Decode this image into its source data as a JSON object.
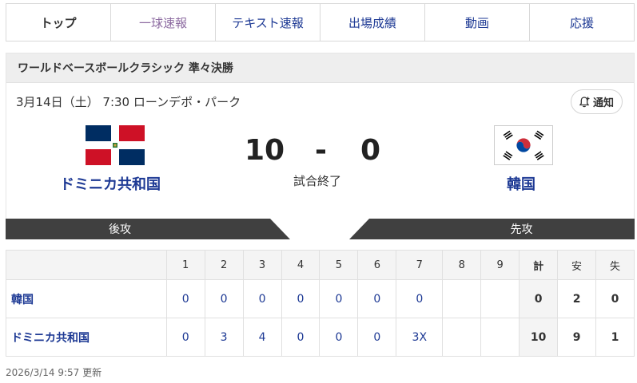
{
  "tabs": [
    {
      "label": "トップ"
    },
    {
      "label": "一球速報"
    },
    {
      "label": "テキスト速報"
    },
    {
      "label": "出場成績"
    },
    {
      "label": "動画"
    },
    {
      "label": "応援"
    }
  ],
  "game": {
    "title": "ワールドベースボールクラシック 準々決勝",
    "dateline": "3月14日（土） 7:30 ローンデポ・パーク",
    "notify_label": "通知",
    "home_team": "ドミニカ共和国",
    "away_team": "韓国",
    "home_score": "10",
    "dash": "-",
    "away_score": "0",
    "status": "試合終了",
    "home_side": "後攻",
    "away_side": "先攻"
  },
  "scoreboard": {
    "headers": [
      "1",
      "2",
      "3",
      "4",
      "5",
      "6",
      "7",
      "8",
      "9",
      "計",
      "安",
      "失"
    ],
    "rows": [
      {
        "team": "韓国",
        "innings": [
          "0",
          "0",
          "0",
          "0",
          "0",
          "0",
          "0",
          "",
          ""
        ],
        "runs": "0",
        "hits": "2",
        "errors": "0"
      },
      {
        "team": "ドミニカ共和国",
        "innings": [
          "0",
          "3",
          "4",
          "0",
          "0",
          "0",
          "3X",
          "",
          ""
        ],
        "runs": "10",
        "hits": "9",
        "errors": "1"
      }
    ]
  },
  "updated": "2026/3/14 9:57 更新"
}
